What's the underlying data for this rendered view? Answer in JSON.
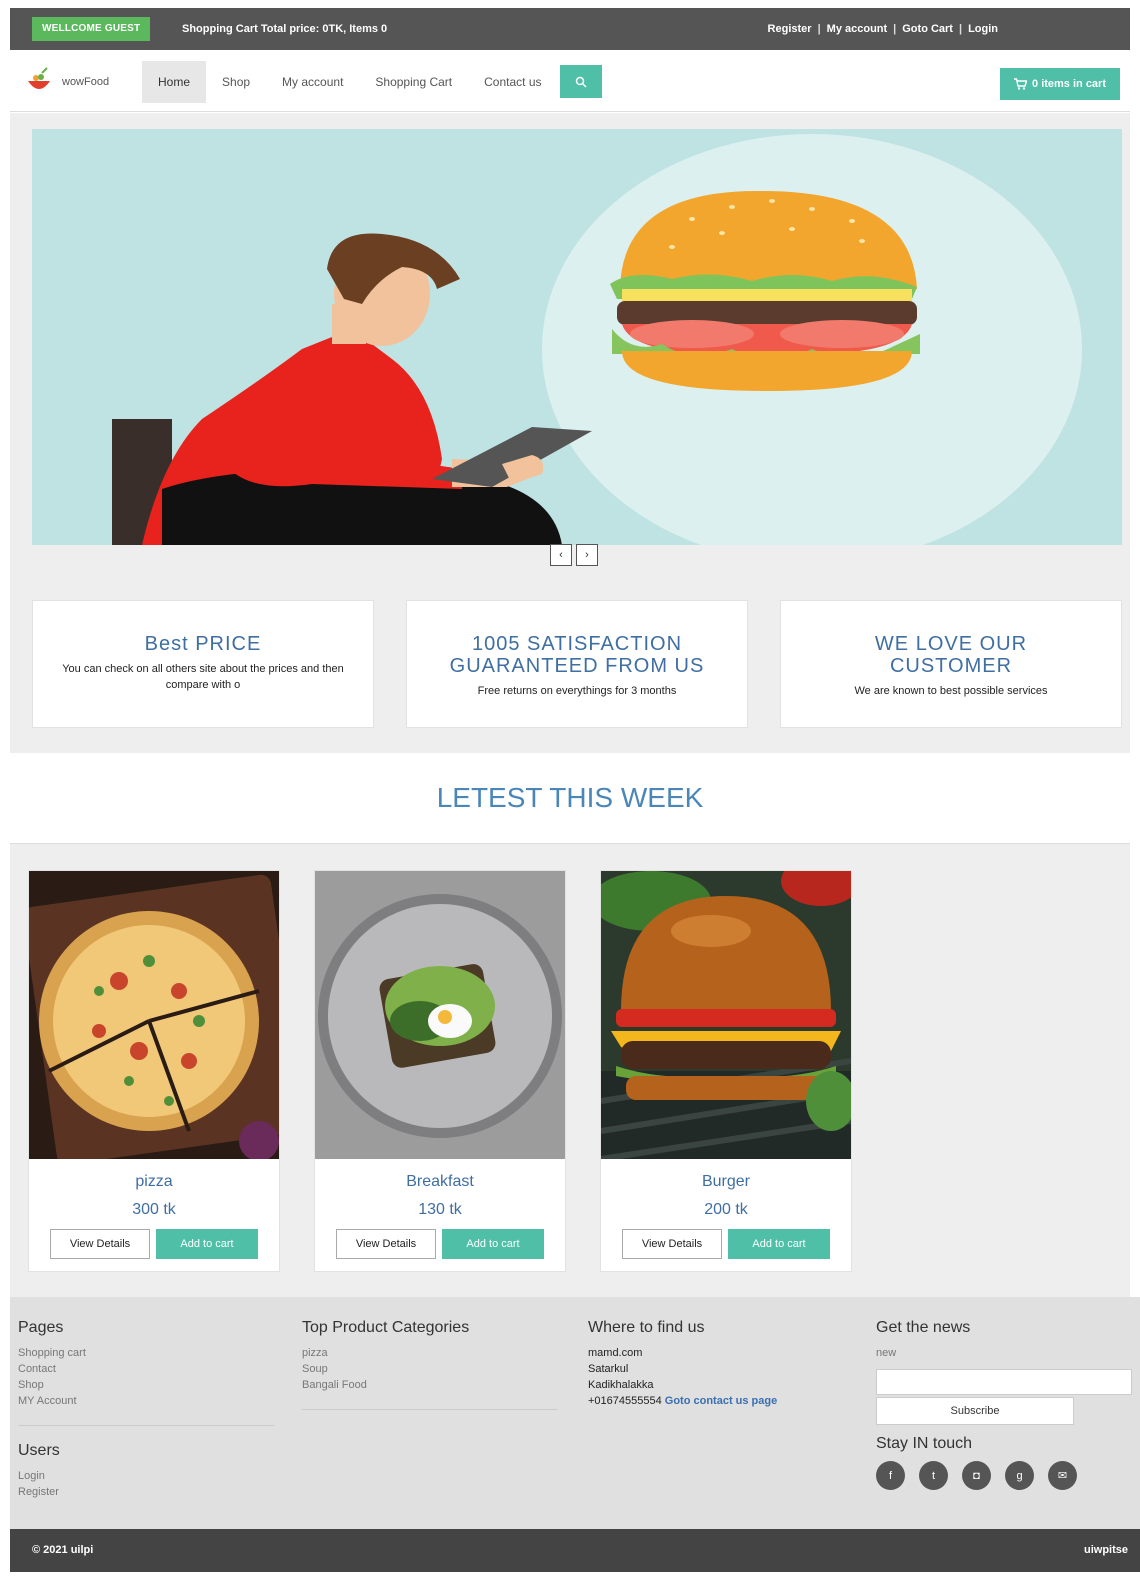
{
  "topbar": {
    "welcome": "WELLCOME GUEST",
    "offer": "Shopping Cart Total price: 0TK, Items 0",
    "links": [
      "Register",
      "My account",
      "Goto Cart",
      "Login"
    ]
  },
  "nav": {
    "logo_text": "wowFood",
    "items": [
      "Home",
      "Shop",
      "My account",
      "Shopping Cart",
      "Contact us"
    ],
    "cart_label": "0 items in cart"
  },
  "slider": {
    "prev": "‹",
    "next": "›"
  },
  "features": [
    {
      "title": "Best PRICE",
      "text": "You can check on all others site about the prices and then compare with o"
    },
    {
      "title": "1005 SATISFACTION GUARANTEED FROM US",
      "text": "Free returns on everythings for 3 months"
    },
    {
      "title": "WE LOVE OUR CUSTOMER",
      "text": "We are known to best possible services"
    }
  ],
  "latest": {
    "title": "LETEST THIS WEEK",
    "products": [
      {
        "name": "pizza",
        "price": "300 tk",
        "view": "View Details",
        "add": "Add to cart"
      },
      {
        "name": "Breakfast",
        "price": "130 tk",
        "view": "View Details",
        "add": "Add to cart"
      },
      {
        "name": "Burger",
        "price": "200 tk",
        "view": "View Details",
        "add": "Add to cart"
      }
    ]
  },
  "footer": {
    "pages": {
      "title": "Pages",
      "links": [
        "Shopping cart",
        "Contact",
        "Shop",
        "MY Account"
      ]
    },
    "users": {
      "title": "Users",
      "links": [
        "Login",
        "Register"
      ]
    },
    "categories": {
      "title": "Top Product Categories",
      "links": [
        "pizza",
        "Soup",
        "Bangali Food"
      ]
    },
    "where": {
      "title": "Where to find us",
      "lines": [
        "mamd.com",
        "Satarkul",
        "Kadikhalakka",
        "+01674555554"
      ],
      "goto": "Goto contact us page"
    },
    "news": {
      "title": "Get the news",
      "label": "new",
      "subscribe": "Subscribe",
      "stay": "Stay IN touch"
    }
  },
  "bottom": {
    "copyright": "© 2021 uilpi",
    "brand": "uiwpitse"
  },
  "colors": {
    "accent": "#4fbfa8",
    "heading_blue": "#3f6ea3",
    "welcome_green": "#5cb85c",
    "topbar": "#555555"
  }
}
